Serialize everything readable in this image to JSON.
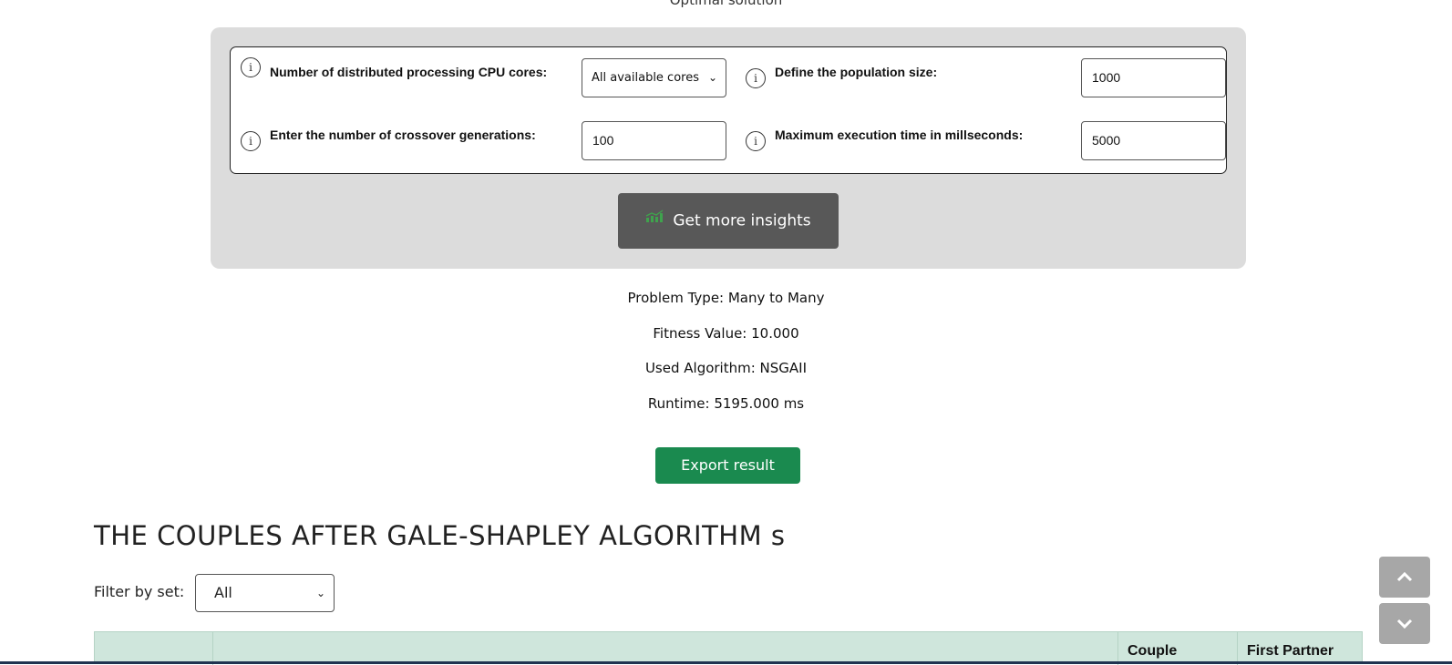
{
  "section_heading": "Optimal solution",
  "params": {
    "cpu_label": "Number of distributed processing CPU cores:",
    "cpu_value": "All available cores",
    "population_label": "Define the population size:",
    "population_value": "1000",
    "generations_label": "Enter the number of crossover generations:",
    "generations_value": "100",
    "time_label": "Maximum execution time in millseconds:",
    "time_value": "5000"
  },
  "insights_button": "Get more insights",
  "results": {
    "problem_type": "Problem Type: Many to Many",
    "fitness": "Fitness Value: 10.000",
    "algorithm": "Used Algorithm: NSGAII",
    "runtime": "Runtime: 5195.000 ms"
  },
  "export_button": "Export result",
  "couples_title": "THE COUPLES AFTER GALE-SHAPLEY ALGORITHM s",
  "filter": {
    "label": "Filter by set:",
    "value": "All"
  },
  "table": {
    "headers": [
      "",
      "",
      "Couple",
      "First Partner"
    ]
  },
  "colors": {
    "panel": "#dcdcdc",
    "insights_button": "#585858",
    "export_button": "#1a8a4f",
    "table_header": "#cfe6dc"
  },
  "icons": [
    "info-icon",
    "chart-icon",
    "chevron-down-icon",
    "chevron-up-icon"
  ]
}
